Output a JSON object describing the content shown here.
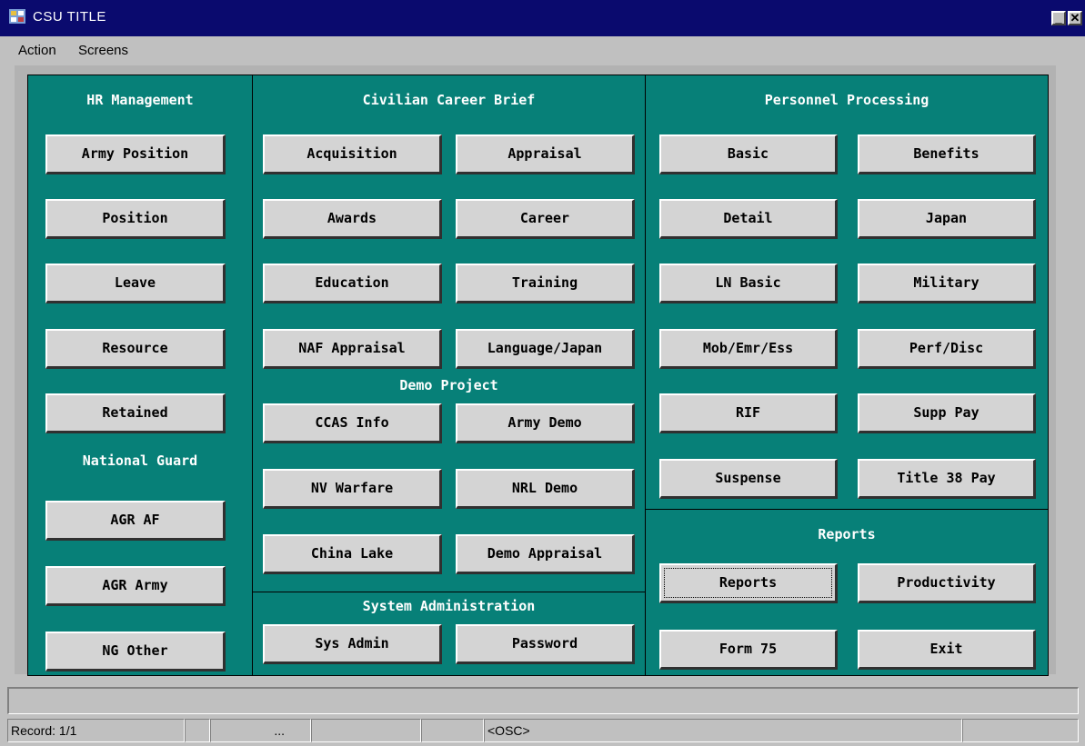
{
  "window": {
    "title": "CSU TITLE",
    "min_glyph": "_",
    "close_glyph": "✕"
  },
  "menu": {
    "action": "Action",
    "screens": "Screens"
  },
  "hr": {
    "title": "HR Management",
    "army_position": "Army Position",
    "position": "Position",
    "leave": "Leave",
    "resource": "Resource",
    "retained": "Retained"
  },
  "guard": {
    "title": "National Guard",
    "agr_af": "AGR AF",
    "agr_army": "AGR Army",
    "ng_other": "NG Other"
  },
  "career": {
    "title": "Civilian Career Brief",
    "acquisition": "Acquisition",
    "appraisal": "Appraisal",
    "awards": "Awards",
    "career": "Career",
    "education": "Education",
    "training": "Training",
    "naf_appraisal": "NAF Appraisal",
    "language_japan": "Language/Japan"
  },
  "demo": {
    "title": "Demo Project",
    "ccas_info": "CCAS Info",
    "army_demo": "Army Demo",
    "nv_warfare": "NV Warfare",
    "nrl_demo": "NRL Demo",
    "china_lake": "China Lake",
    "demo_appraisal": "Demo Appraisal"
  },
  "sysadmin": {
    "title": "System Administration",
    "sys_admin": "Sys Admin",
    "password": "Password"
  },
  "personnel": {
    "title": "Personnel Processing",
    "basic": "Basic",
    "benefits": "Benefits",
    "detail": "Detail",
    "japan": "Japan",
    "ln_basic": "LN Basic",
    "military": "Military",
    "mob_emr_ess": "Mob/Emr/Ess",
    "perf_disc": "Perf/Disc",
    "rif": "RIF",
    "supp_pay": "Supp Pay",
    "suspense": "Suspense",
    "title38_pay": "Title 38 Pay"
  },
  "reports": {
    "title": "Reports",
    "reports": "Reports",
    "productivity": "Productivity",
    "form75": "Form 75",
    "exit": "Exit"
  },
  "status": {
    "record": "Record: 1/1",
    "ellipsis": "...",
    "osc": "<OSC>"
  }
}
